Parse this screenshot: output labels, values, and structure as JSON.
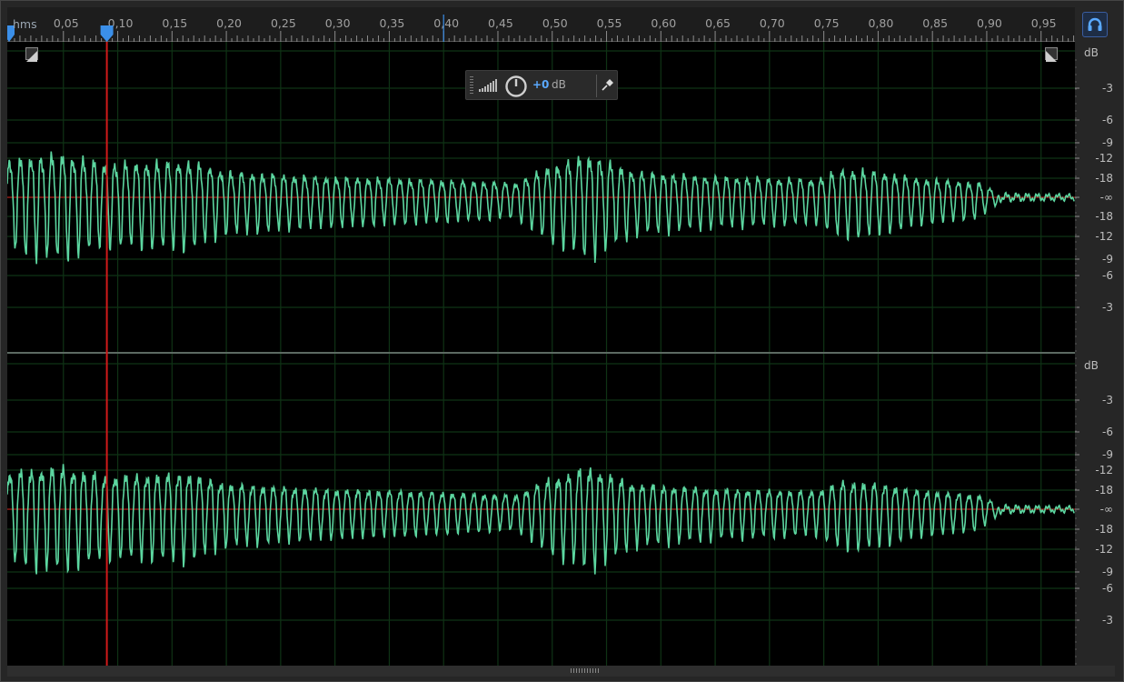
{
  "ruler": {
    "units_label": "hms",
    "tick_labels": [
      "0,05",
      "0,10",
      "0,15",
      "0,20",
      "0,25",
      "0,30",
      "0,35",
      "0,40",
      "0,45",
      "0,50",
      "0,55",
      "0,60",
      "0,65",
      "0,70",
      "0,75",
      "0,80",
      "0,85",
      "0,90",
      "0,95"
    ],
    "cursor_time": 0.09,
    "playhead_time": 0.4
  },
  "db_scale": {
    "unit_label": "dB",
    "labels_upper": [
      "-3",
      "-6",
      "-9",
      "-12",
      "-18",
      "-∞",
      "-18",
      "-12",
      "-9",
      "-6",
      "-3"
    ],
    "labels_lower": [
      "-3",
      "-6",
      "-9",
      "-12",
      "-18",
      "-∞",
      "-18",
      "-12",
      "-9",
      "-6",
      "-3"
    ]
  },
  "hud": {
    "gain_value": "+0",
    "gain_unit": "dB"
  },
  "colors": {
    "waveform": "#5cd6a0",
    "center_line": "#b01818",
    "cursor": "#d11a1a",
    "grid": "#0f3315",
    "accent": "#3b8fe8"
  },
  "icons": {
    "monitor": "headphones-icon",
    "hud_level": "level-bars-icon",
    "hud_power": "power-icon",
    "hud_pin": "pin-icon"
  }
}
